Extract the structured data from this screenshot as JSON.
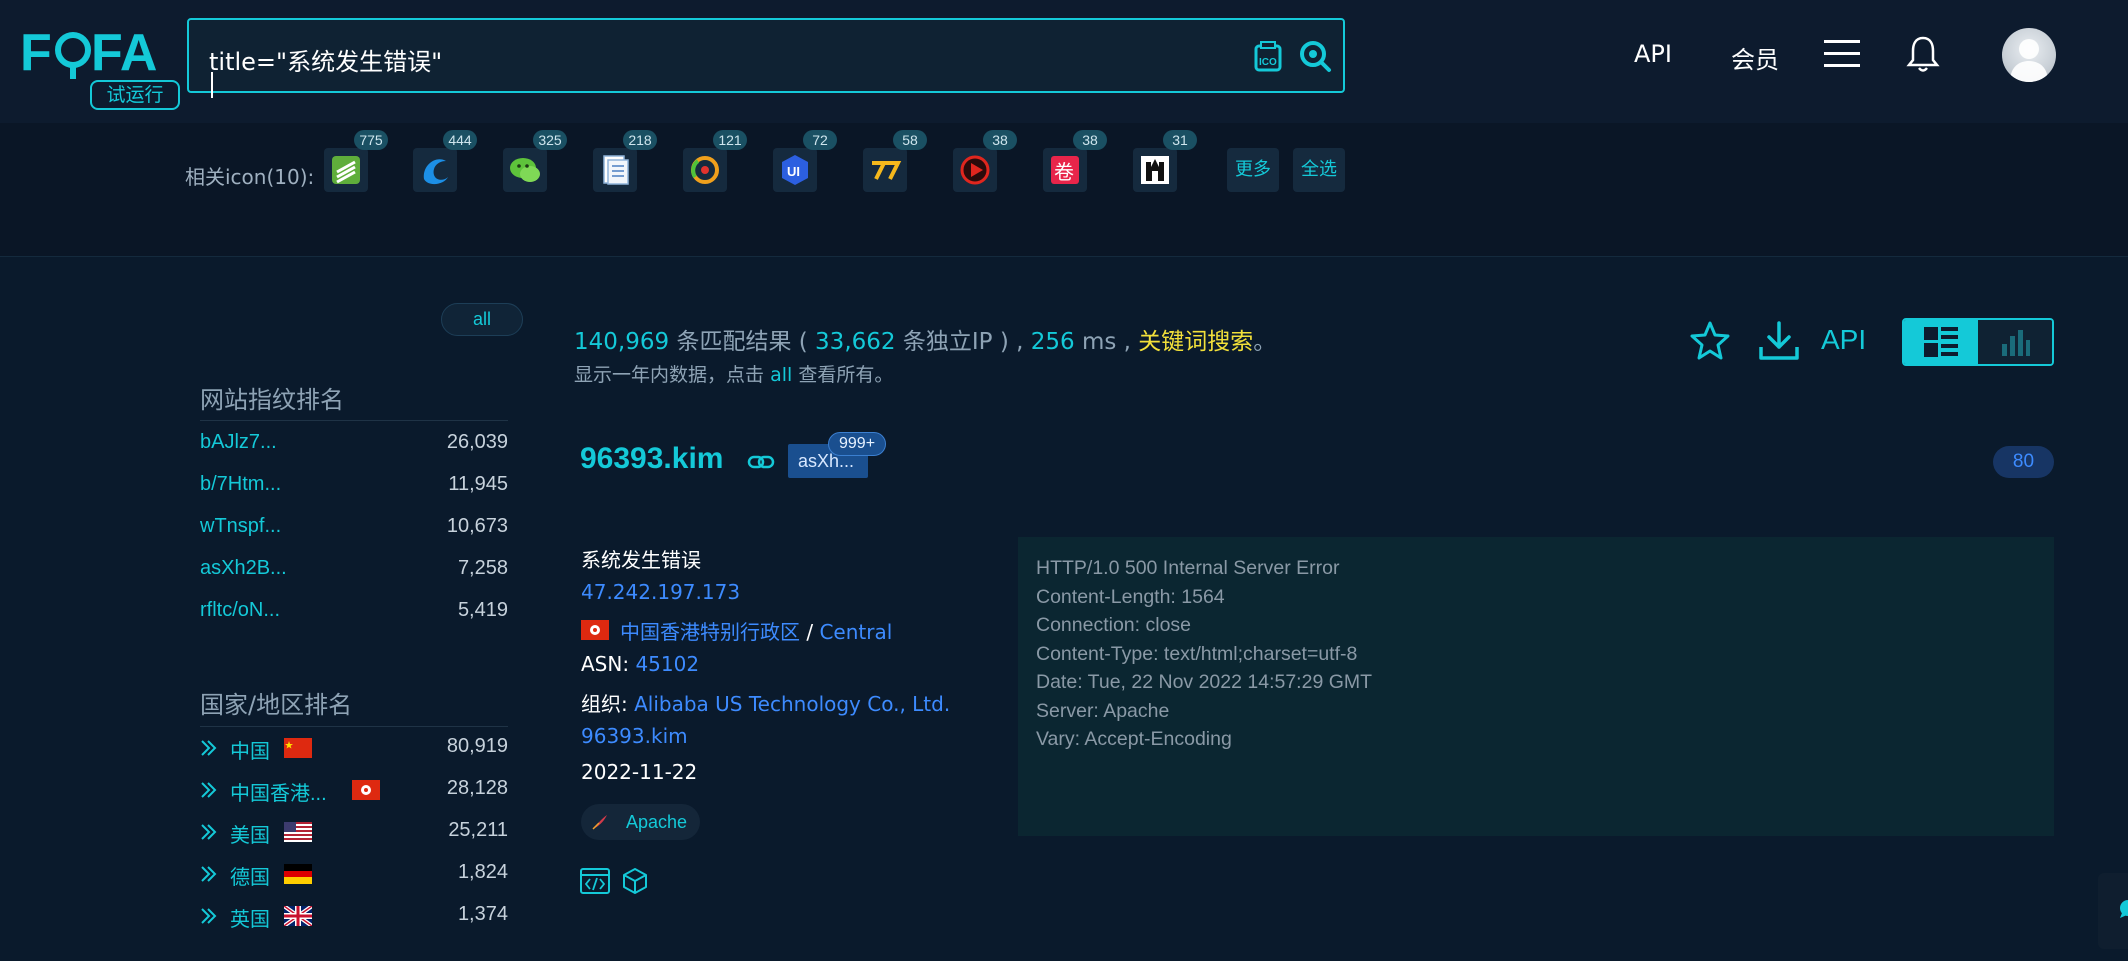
{
  "header": {
    "logo": "FOFA",
    "logo_badge": "试运行",
    "search_value": "title=\"系统发生错误\"",
    "nav": [
      "API",
      "会员"
    ]
  },
  "icon_bar": {
    "label": "相关icon(10):",
    "icons": [
      {
        "name": "green-stack-icon",
        "count": "775"
      },
      {
        "name": "blue-swirl-icon",
        "count": "444"
      },
      {
        "name": "wechat-icon",
        "count": "325"
      },
      {
        "name": "document-icon",
        "count": "218"
      },
      {
        "name": "colorful-circle-icon",
        "count": "121"
      },
      {
        "name": "ui-badge-icon",
        "count": "72"
      },
      {
        "name": "yellow-77-icon",
        "count": "58"
      },
      {
        "name": "red-play-icon",
        "count": "38"
      },
      {
        "name": "red-juan-icon",
        "count": "38"
      },
      {
        "name": "black-tower-icon",
        "count": "31"
      }
    ],
    "more": "更多",
    "select_all": "全选"
  },
  "sidebar": {
    "all": "all",
    "fingerprint_title": "网站指纹排名",
    "fingerprints": [
      {
        "name": "bAJlz7...",
        "value": "26,039"
      },
      {
        "name": "b/7Htm...",
        "value": "11,945"
      },
      {
        "name": "wTnspf...",
        "value": "10,673"
      },
      {
        "name": "asXh2B...",
        "value": "7,258"
      },
      {
        "name": "rfltc/oN...",
        "value": "5,419"
      }
    ],
    "country_title": "国家/地区排名",
    "countries": [
      {
        "name": "中国",
        "flag": "cn",
        "value": "80,919"
      },
      {
        "name": "中国香港...",
        "flag": "hk",
        "value": "28,128"
      },
      {
        "name": "美国",
        "flag": "us",
        "value": "25,211"
      },
      {
        "name": "德国",
        "flag": "de",
        "value": "1,824"
      },
      {
        "name": "英国",
        "flag": "gb",
        "value": "1,374"
      }
    ]
  },
  "summary": {
    "total": "140,969",
    "matches": "条匹配结果",
    "unique_open": "(",
    "unique": "33,662",
    "unique_label": "条独立IP",
    "unique_close": ") ,",
    "ms": "256",
    "ms_label": "ms ,",
    "keyword": "关键词搜索",
    "end": "。",
    "note_pre": "显示一年内数据，点击",
    "note_link": "all",
    "note_post": "查看所有。",
    "api": "API"
  },
  "result": {
    "host": "96393.kim",
    "tag": "asXh...",
    "tag_count": "999+",
    "port": "80",
    "title": "系统发生错误",
    "ip": "47.242.197.173",
    "region": "中国香港特别行政区",
    "slash": "/",
    "city": "Central",
    "asn_label": "ASN:",
    "asn": "45102",
    "org_label": "组织:",
    "org": "Alibaba US Technology Co., Ltd.",
    "domain": "96393.kim",
    "date": "2022-11-22",
    "server": "Apache",
    "banner": [
      "HTTP/1.0 500 Internal Server Error",
      "Content-Length: 1564",
      "Connection: close",
      "Content-Type: text/html;charset=utf-8",
      "Date: Tue, 22 Nov 2022 14:57:29 GMT",
      "Server: Apache",
      "Vary: Accept-Encoding"
    ]
  },
  "colors": {
    "accent": "#14c9d8",
    "link": "#3d8bff",
    "keyword": "#f2e03a",
    "background": "#0a1a2c"
  }
}
